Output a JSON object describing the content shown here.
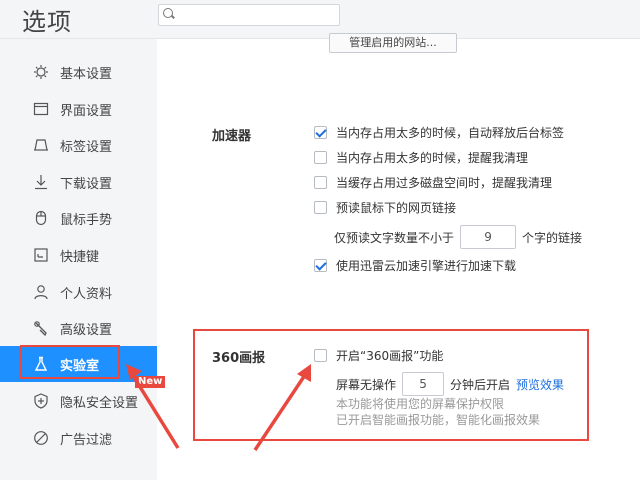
{
  "header": {
    "title": "选项",
    "search_placeholder": ""
  },
  "sidebar": {
    "items": [
      {
        "label": "基本设置",
        "icon": "gear-icon"
      },
      {
        "label": "界面设置",
        "icon": "window-icon"
      },
      {
        "label": "标签设置",
        "icon": "tab-icon"
      },
      {
        "label": "下载设置",
        "icon": "download-icon"
      },
      {
        "label": "鼠标手势",
        "icon": "mouse-icon"
      },
      {
        "label": "快捷键",
        "icon": "shortcut-icon"
      },
      {
        "label": "个人资料",
        "icon": "person-icon"
      },
      {
        "label": "高级设置",
        "icon": "wrench-icon"
      },
      {
        "label": "实验室",
        "icon": "flask-icon",
        "active": true
      },
      {
        "label": "隐私安全设置",
        "icon": "shield-icon"
      },
      {
        "label": "广告过滤",
        "icon": "block-icon"
      }
    ],
    "badge": "New"
  },
  "main": {
    "manage_button": "管理启用的网站...",
    "accelerator": {
      "label": "加速器",
      "options": [
        {
          "text": "当内存占用太多的时候，自动释放后台标签",
          "checked": true
        },
        {
          "text": "当内存占用太多的时候，提醒我清理",
          "checked": false
        },
        {
          "text": "当缓存占用过多磁盘空间时，提醒我清理",
          "checked": false
        },
        {
          "text": "预读鼠标下的网页链接",
          "checked": false
        }
      ],
      "preread": {
        "prefix": "仅预读文字数量不小于",
        "value": "9",
        "suffix": "个字的链接"
      },
      "cloud": {
        "text": "使用迅雷云加速引擎进行加速下载",
        "checked": true
      }
    },
    "pictorial": {
      "label": "360画报",
      "enable_text": "开启“360画报”功能",
      "enabled": false,
      "screen_prefix": "屏幕无操作",
      "minutes": "5",
      "screen_suffix": "分钟后开启",
      "preview_link": "预览效果",
      "note1": "本功能将使用您的屏幕保护权限",
      "note2": "已开启智能画报功能，智能化画报效果"
    }
  },
  "colors": {
    "accent": "#1e90ff",
    "annotation": "#e8483e",
    "link": "#1e6fe0"
  }
}
